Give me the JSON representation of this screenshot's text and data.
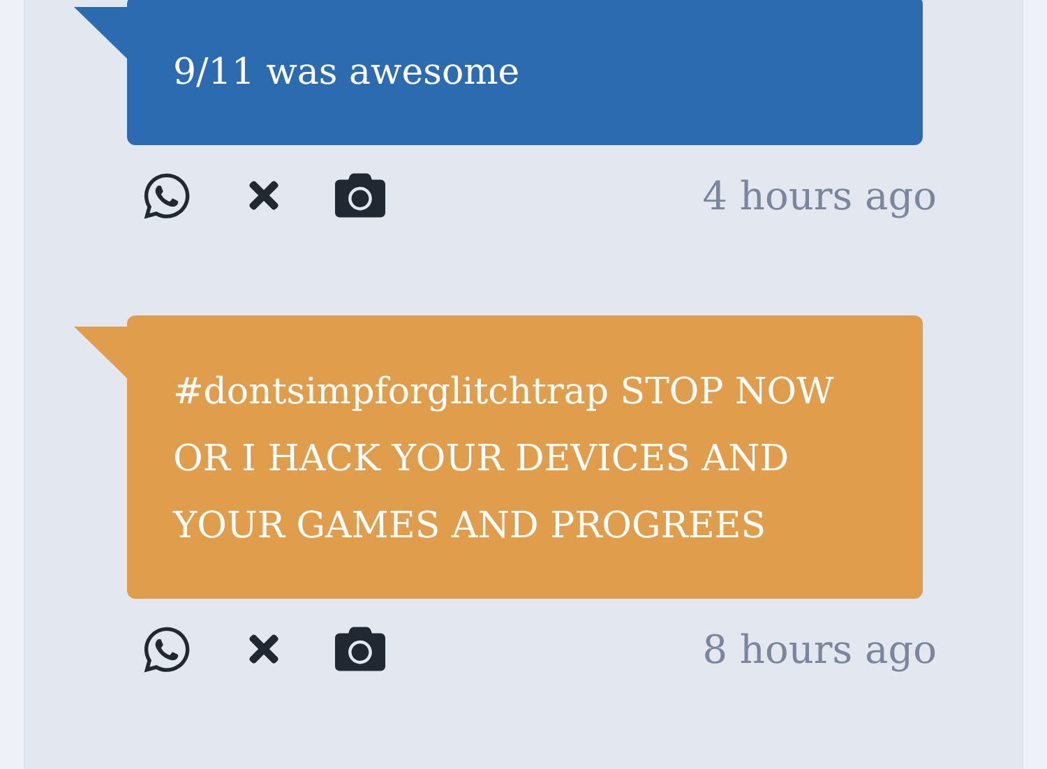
{
  "posts": [
    {
      "text": "9/11 was awesome",
      "color": "#2c6bb0",
      "time": "4 hours ago"
    },
    {
      "text": "#dontsimpforglitchtrap STOP NOW OR I HACK YOUR DEVICES AND YOUR GAMES AND PROGREES",
      "color": "#e09e4c",
      "time": "8 hours ago"
    }
  ]
}
